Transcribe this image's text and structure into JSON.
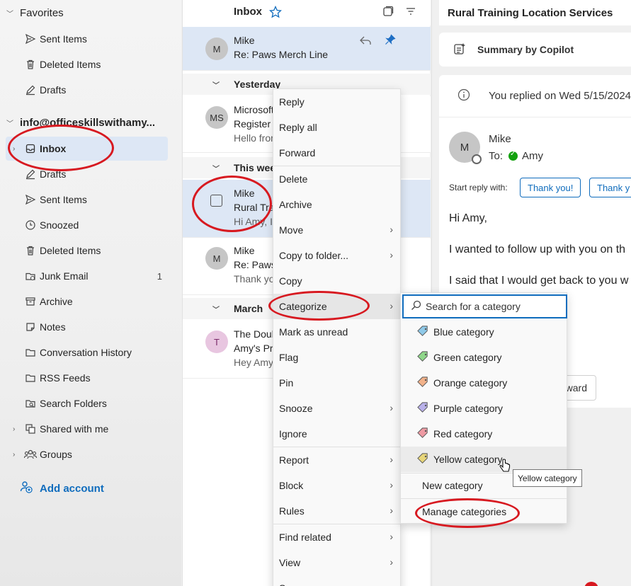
{
  "folders": {
    "favorites_label": "Favorites",
    "favorites": [
      {
        "label": "Sent Items",
        "icon": "send-icon"
      },
      {
        "label": "Deleted Items",
        "icon": "trash-icon"
      },
      {
        "label": "Drafts",
        "icon": "pencil-icon"
      }
    ],
    "account_label": "info@officeskillswithamy...",
    "account_folders": [
      {
        "label": "Inbox",
        "icon": "inbox-icon",
        "count": ""
      },
      {
        "label": "Drafts",
        "icon": "pencil-icon",
        "count": ""
      },
      {
        "label": "Sent Items",
        "icon": "send-icon",
        "count": ""
      },
      {
        "label": "Snoozed",
        "icon": "clock-icon",
        "count": ""
      },
      {
        "label": "Deleted Items",
        "icon": "trash-icon",
        "count": ""
      },
      {
        "label": "Junk Email",
        "icon": "junk-icon",
        "count": "1"
      },
      {
        "label": "Archive",
        "icon": "archive-icon",
        "count": ""
      },
      {
        "label": "Notes",
        "icon": "note-icon",
        "count": ""
      },
      {
        "label": "Conversation History",
        "icon": "folder-icon",
        "count": ""
      },
      {
        "label": "RSS Feeds",
        "icon": "folder-icon",
        "count": ""
      },
      {
        "label": "Search Folders",
        "icon": "search-folder-icon",
        "count": ""
      },
      {
        "label": "Shared with me",
        "icon": "shared-icon",
        "count": ""
      },
      {
        "label": "Groups",
        "icon": "groups-icon",
        "count": ""
      }
    ],
    "add_account": "Add account"
  },
  "list": {
    "title": "Inbox",
    "pinned": {
      "avatar": "M",
      "sender": "Mike",
      "subject": "Re: Paws Merch Line"
    },
    "groups": {
      "yesterday": "Yesterday",
      "this_week": "This week",
      "march": "March"
    },
    "messages": [
      {
        "avatar": "MS",
        "sender": "Microsoft",
        "subject": "Register u",
        "preview": "Hello from"
      },
      {
        "avatar": "",
        "sender": "Mike",
        "subject": "Rural Trai",
        "preview": "Hi Amy, I"
      },
      {
        "avatar": "M",
        "sender": "Mike",
        "subject": "Re: Paws",
        "preview": "Thank yo"
      },
      {
        "avatar": "T",
        "sender": "The Doub",
        "subject": "Amy's Pro",
        "preview": "Hey Amy"
      }
    ]
  },
  "reading": {
    "title": "Rural Training Location Services",
    "copilot": "Summary by Copilot",
    "replied": "You replied on Wed 5/15/2024",
    "avatar": "M",
    "sender": "Mike",
    "to_label": "To:",
    "to_name": "Amy",
    "start_reply": "Start reply with:",
    "quick_replies": [
      "Thank you!",
      "Thank y"
    ],
    "body": [
      "Hi Amy,",
      "I wanted to follow up with you on th",
      "I said that I would get back to you w"
    ],
    "forward_fragment": "ward"
  },
  "context_menu": {
    "items": [
      "Reply",
      "Reply all",
      "Forward",
      "Delete",
      "Archive",
      "Move",
      "Copy to folder...",
      "Copy",
      "Categorize",
      "Mark as unread",
      "Flag",
      "Pin",
      "Snooze",
      "Ignore",
      "Report",
      "Block",
      "Rules",
      "Find related",
      "View",
      "S"
    ]
  },
  "categorize": {
    "search_placeholder": "Search for a category",
    "categories": [
      {
        "label": "Blue category",
        "color": "#8fc9e8"
      },
      {
        "label": "Green category",
        "color": "#8fd68a"
      },
      {
        "label": "Orange category",
        "color": "#f2b28a"
      },
      {
        "label": "Purple category",
        "color": "#b9b1ea"
      },
      {
        "label": "Red category",
        "color": "#ee9aa3"
      },
      {
        "label": "Yellow category",
        "color": "#e8d67a"
      }
    ],
    "new_category": "New category",
    "manage_categories": "Manage categories",
    "tooltip": "Yellow category"
  },
  "colors": {
    "accent": "#0f6cbd",
    "selection": "#dde7f5",
    "annotation": "#d71920"
  }
}
